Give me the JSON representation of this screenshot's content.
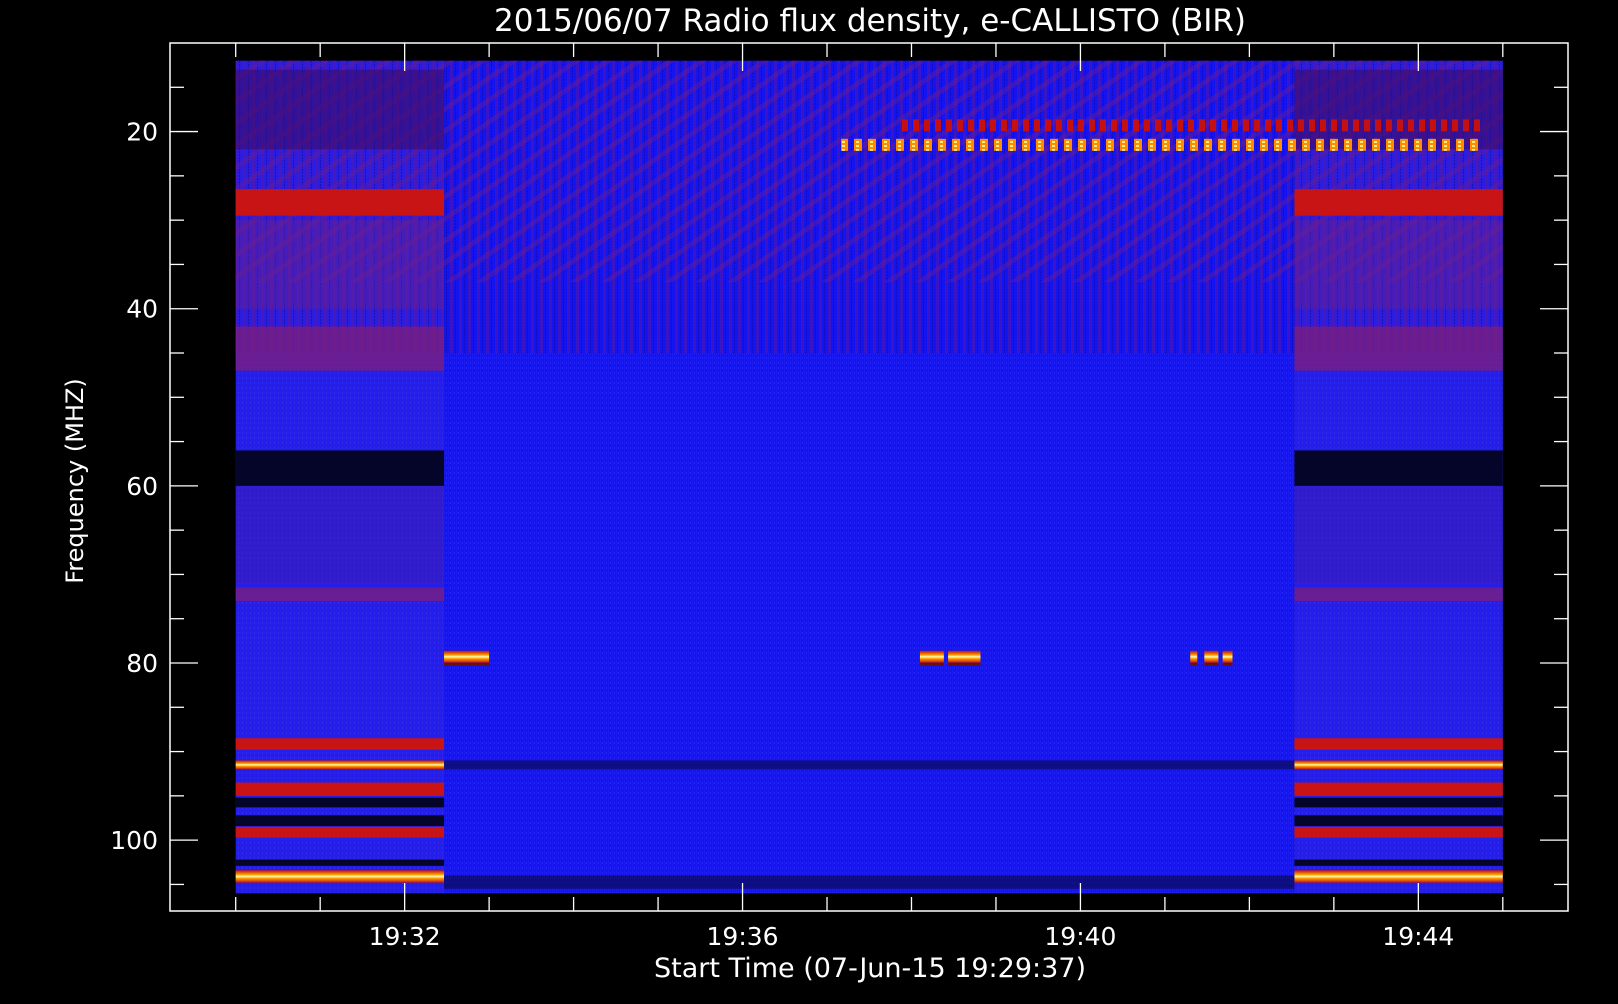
{
  "chart_data": {
    "type": "heatmap",
    "title": "2015/06/07  Radio flux density, e-CALLISTO (BIR)",
    "xlabel": "Start Time (07-Jun-15 19:29:37)",
    "ylabel": "Frequency (MHZ)",
    "x_axis": {
      "unit": "time (UT)",
      "range": [
        "19:30:00",
        "19:45:00"
      ],
      "data_span": [
        "19:30:00",
        "19:45:00"
      ],
      "major_ticks": [
        "19:32",
        "19:36",
        "19:40",
        "19:44"
      ],
      "minor_tick_step_minutes": 1
    },
    "y_axis": {
      "unit": "MHz",
      "range": [
        10,
        108
      ],
      "inverted": true,
      "data_span": [
        12,
        106
      ],
      "major_ticks": [
        20,
        40,
        60,
        80,
        100
      ],
      "minor_tick_step": 5
    },
    "colormap": [
      "#000000",
      "#1010d8",
      "#2020ff",
      "#7a1a8a",
      "#c01010",
      "#ff4000",
      "#ffa000",
      "#ffff80"
    ],
    "background_segments": [
      {
        "start": "19:30:00",
        "end": "19:32:28",
        "level": "high"
      },
      {
        "start": "19:32:28",
        "end": "19:42:32",
        "level": "low"
      },
      {
        "start": "19:42:32",
        "end": "19:45:00",
        "level": "high"
      }
    ],
    "horizontal_bands": [
      {
        "freq": [
          26.5,
          29.5
        ],
        "segments": "high",
        "intensity": "red"
      },
      {
        "freq": [
          42,
          47
        ],
        "segments": "high",
        "intensity": "purple"
      },
      {
        "freq": [
          56,
          60
        ],
        "segments": "high",
        "intensity": "dark"
      },
      {
        "freq": [
          71.5,
          73
        ],
        "segments": "high",
        "intensity": "purple"
      },
      {
        "freq": [
          88.5,
          89.8
        ],
        "segments": "high",
        "intensity": "red"
      },
      {
        "freq": [
          91,
          92
        ],
        "segments": "high",
        "intensity": "bright"
      },
      {
        "freq": [
          91,
          92
        ],
        "segments": "low",
        "intensity": "dark"
      },
      {
        "freq": [
          93.5,
          95
        ],
        "segments": "high",
        "intensity": "red"
      },
      {
        "freq": [
          95.2,
          96.3
        ],
        "segments": "high",
        "intensity": "dark"
      },
      {
        "freq": [
          97.2,
          98.4
        ],
        "segments": "high",
        "intensity": "dark"
      },
      {
        "freq": [
          98.5,
          99.7
        ],
        "segments": "high",
        "intensity": "red"
      },
      {
        "freq": [
          102.2,
          102.9
        ],
        "segments": "high",
        "intensity": "dark"
      },
      {
        "freq": [
          103.4,
          104.8
        ],
        "segments": "high",
        "intensity": "bright"
      },
      {
        "freq": [
          104,
          105.5
        ],
        "segments": "low",
        "intensity": "dark"
      }
    ],
    "rfi_bursts": [
      {
        "freq": 21.5,
        "start": "19:37:10",
        "end": "19:44:45",
        "intensity": "orange"
      },
      {
        "freq": 19.3,
        "start": "19:37:50",
        "end": "19:44:45",
        "intensity": "red"
      },
      {
        "freq": 79.3,
        "start": "19:32:28",
        "end": "19:33:00",
        "intensity": "bright"
      },
      {
        "freq": 79.3,
        "start": "19:38:06",
        "end": "19:38:23",
        "intensity": "bright"
      },
      {
        "freq": 79.3,
        "start": "19:38:26",
        "end": "19:38:49",
        "intensity": "bright"
      },
      {
        "freq": 79.3,
        "start": "19:41:18",
        "end": "19:41:23",
        "intensity": "bright"
      },
      {
        "freq": 79.3,
        "start": "19:41:28",
        "end": "19:41:38",
        "intensity": "bright"
      },
      {
        "freq": 79.3,
        "start": "19:41:41",
        "end": "19:41:48",
        "intensity": "bright"
      }
    ],
    "grid": false,
    "legend": "none"
  }
}
